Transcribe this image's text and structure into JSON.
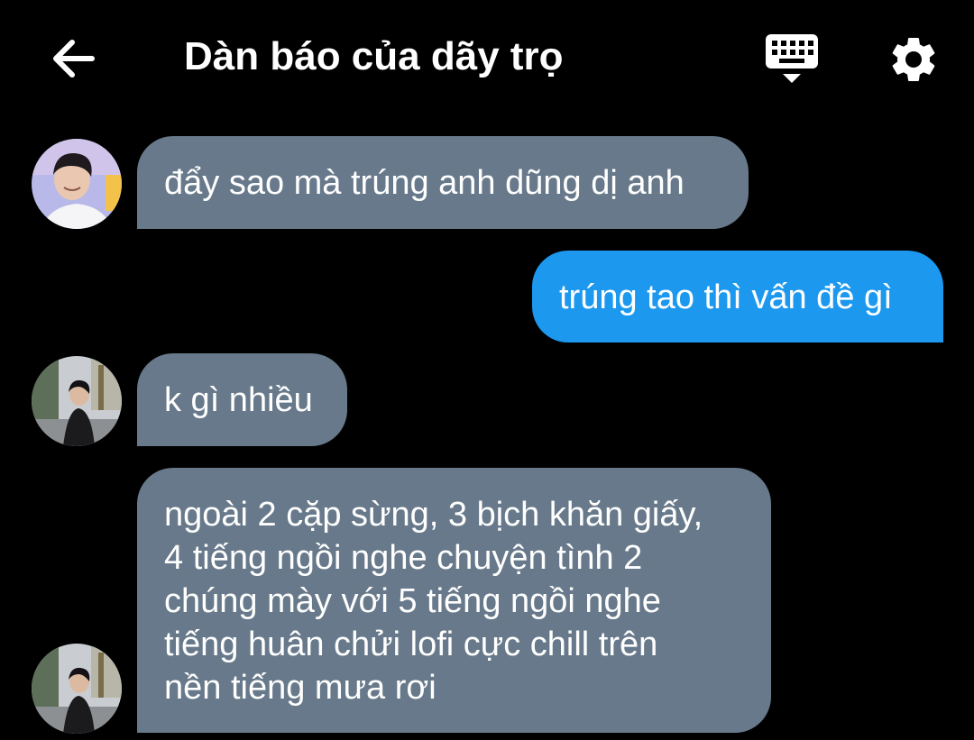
{
  "header": {
    "title": "Dàn báo của dãy trọ",
    "back_icon": "arrow-left-icon",
    "keyboard_icon": "keyboard-icon",
    "settings_icon": "gear-icon"
  },
  "colors": {
    "background": "#000000",
    "incoming_bubble": "#67798a",
    "outgoing_bubble": "#1c98ef",
    "text": "#ffffff"
  },
  "messages": [
    {
      "direction": "incoming",
      "avatar": "avatar-1",
      "lines": [
        "đẩy sao mà trúng anh dũng dị anh"
      ]
    },
    {
      "direction": "outgoing",
      "lines": [
        "trúng tao thì vấn đề gì"
      ]
    },
    {
      "direction": "incoming",
      "avatar": "avatar-2",
      "lines": [
        "k gì nhiều"
      ]
    },
    {
      "direction": "incoming",
      "avatar": "avatar-2",
      "lines": [
        "ngoài 2 cặp sừng, 3 bịch khăn giấy,",
        "4 tiếng ngồi nghe chuyện tình 2",
        "chúng mày với 5 tiếng ngồi nghe",
        "tiếng huân chửi lofi cực chill trên",
        "nền tiếng mưa rơi"
      ]
    }
  ]
}
